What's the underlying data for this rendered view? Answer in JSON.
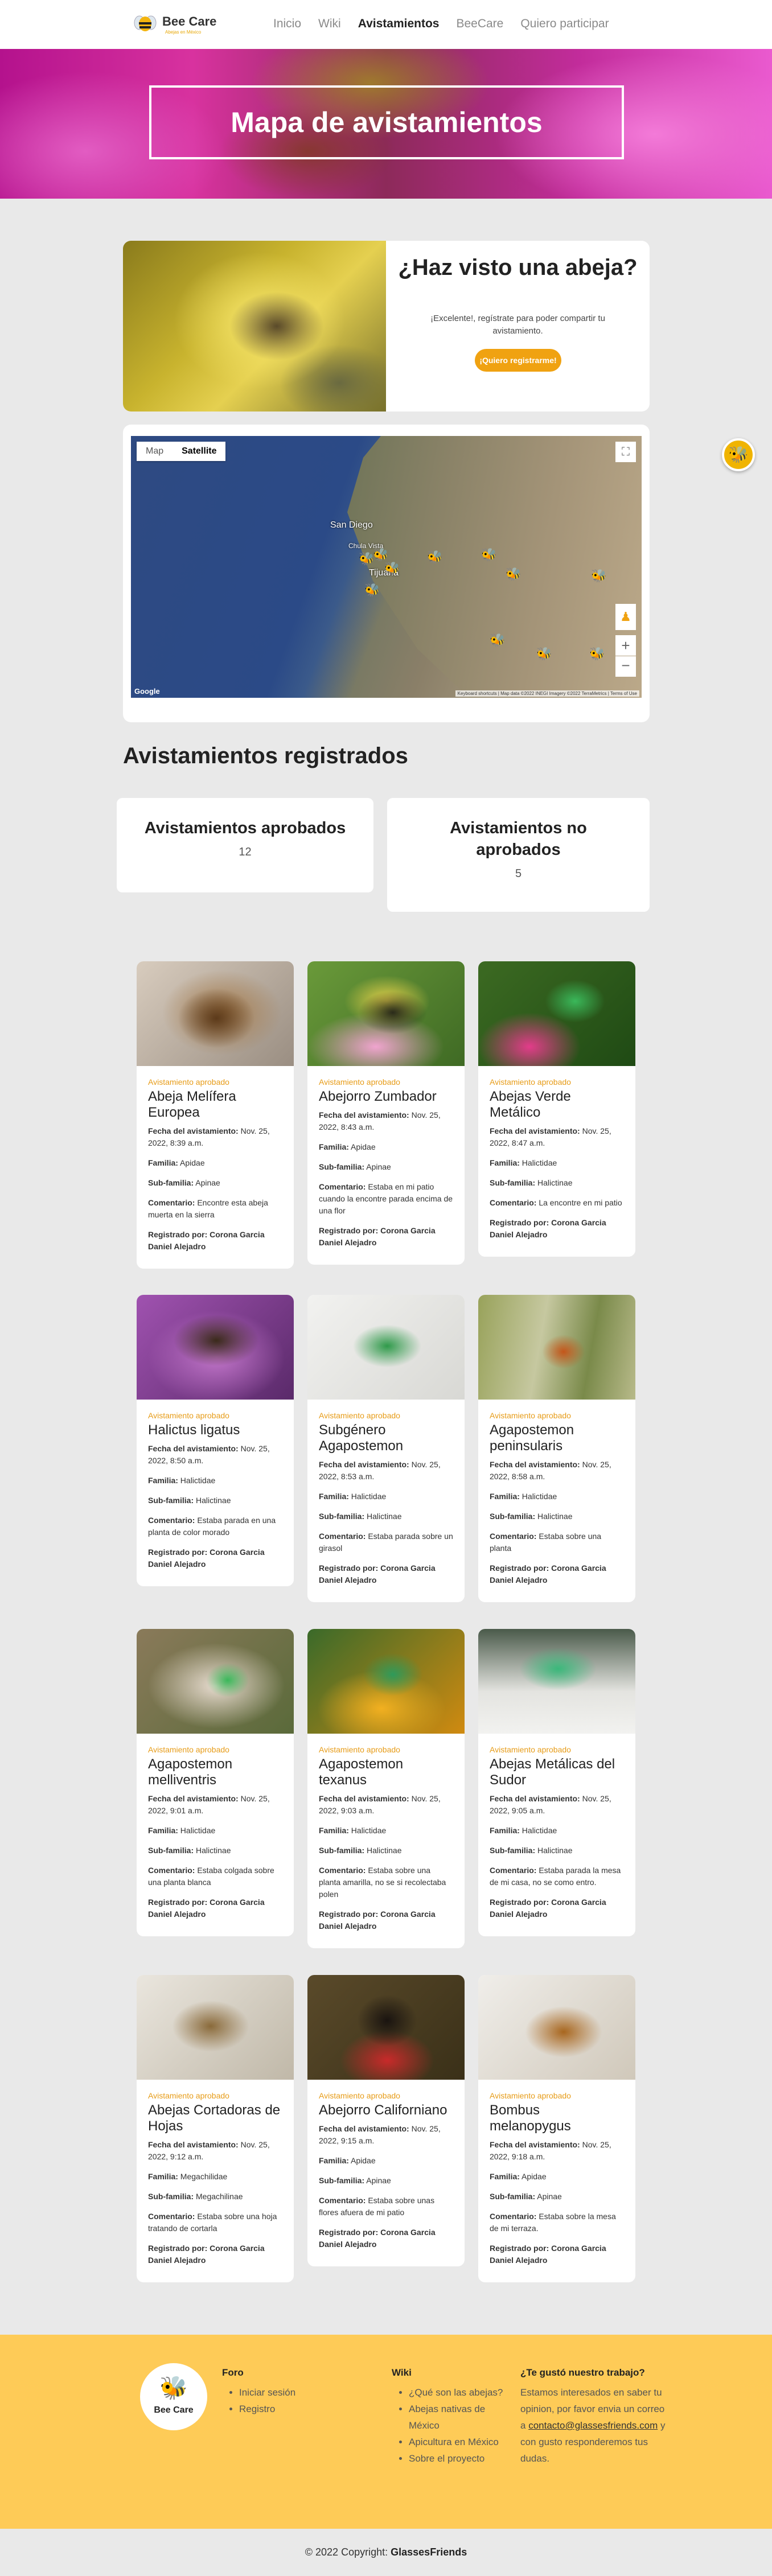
{
  "nav": {
    "brand": "Bee Care",
    "brand_sub": "Abejas en México",
    "links": [
      "Inicio",
      "Wiki",
      "Avistamientos",
      "BeeCare",
      "Quiero participar"
    ],
    "active": "Avistamientos"
  },
  "hero": {
    "title": "Mapa de avistamientos"
  },
  "signup": {
    "title": "¿Haz visto una abeja?",
    "text": "¡Excelente!, regístrate para poder compartir tu avistamiento.",
    "button": "¡Quiero registrarme!"
  },
  "map": {
    "type_map": "Map",
    "type_satellite": "Satellite",
    "label_sd": "San Diego",
    "label_chula": "Chula Vista",
    "label_tijuana": "Tijuana",
    "google": "Google",
    "attribution": "Keyboard shortcuts | Map data ©2022 INEGI Imagery ©2022 TerraMetrics | Terms of Use"
  },
  "registered": {
    "title": "Avistamientos registrados",
    "approved_label": "Avistamientos aprobados",
    "approved_count": "12",
    "not_approved_label": "Avistamientos no aprobados",
    "not_approved_count": "5"
  },
  "labels": {
    "date": "Fecha del avistamiento:",
    "family": "Familia:",
    "subfamily": "Sub-familia:",
    "comment": "Comentario:",
    "registered_by": "Registrado por:"
  },
  "sightings": [
    {
      "status": "Avistamiento aprobado",
      "name": "Abeja Melífera Europea",
      "date": "Nov. 25, 2022, 8:39 a.m.",
      "family": "Apidae",
      "subfamily": "Apinae",
      "comment": "Encontre esta abeja muerta en la sierra",
      "by": "Corona Garcia Daniel Alejadro"
    },
    {
      "status": "Avistamiento aprobado",
      "name": "Abejorro Zumbador",
      "date": "Nov. 25, 2022, 8:43 a.m.",
      "family": "Apidae",
      "subfamily": "Apinae",
      "comment": "Estaba en mi patio cuando la encontre parada encima de una flor",
      "by": "Corona Garcia Daniel Alejadro"
    },
    {
      "status": "Avistamiento aprobado",
      "name": "Abejas Verde Metálico",
      "date": "Nov. 25, 2022, 8:47 a.m.",
      "family": "Halictidae",
      "subfamily": "Halictinae",
      "comment": "La encontre en mi patio",
      "by": "Corona Garcia Daniel Alejadro"
    },
    {
      "status": "Avistamiento aprobado",
      "name": "Halictus ligatus",
      "date": "Nov. 25, 2022, 8:50 a.m.",
      "family": "Halictidae",
      "subfamily": "Halictinae",
      "comment": "Estaba parada en una planta de color morado",
      "by": "Corona Garcia Daniel Alejadro"
    },
    {
      "status": "Avistamiento aprobado",
      "name": "Subgénero Agapostemon",
      "date": "Nov. 25, 2022, 8:53 a.m.",
      "family": "Halictidae",
      "subfamily": "Halictinae",
      "comment": "Estaba parada sobre un girasol",
      "by": "Corona Garcia Daniel Alejadro"
    },
    {
      "status": "Avistamiento aprobado",
      "name": "Agapostemon peninsularis",
      "date": "Nov. 25, 2022, 8:58 a.m.",
      "family": "Halictidae",
      "subfamily": "Halictinae",
      "comment": "Estaba sobre una planta",
      "by": "Corona Garcia Daniel Alejadro"
    },
    {
      "status": "Avistamiento aprobado",
      "name": "Agapostemon melliventris",
      "date": "Nov. 25, 2022, 9:01 a.m.",
      "family": "Halictidae",
      "subfamily": "Halictinae",
      "comment": "Estaba colgada sobre una planta blanca",
      "by": "Corona Garcia Daniel Alejadro"
    },
    {
      "status": "Avistamiento aprobado",
      "name": "Agapostemon texanus",
      "date": "Nov. 25, 2022, 9:03 a.m.",
      "family": "Halictidae",
      "subfamily": "Halictinae",
      "comment": "Estaba sobre una planta amarilla, no se si recolectaba polen",
      "by": "Corona Garcia Daniel Alejadro"
    },
    {
      "status": "Avistamiento aprobado",
      "name": "Abejas Metálicas del Sudor",
      "date": "Nov. 25, 2022, 9:05 a.m.",
      "family": "Halictidae",
      "subfamily": "Halictinae",
      "comment": "Estaba parada la mesa de mi casa, no se como entro.",
      "by": "Corona Garcia Daniel Alejadro"
    },
    {
      "status": "Avistamiento aprobado",
      "name": "Abejas Cortadoras de Hojas",
      "date": "Nov. 25, 2022, 9:12 a.m.",
      "family": "Megachilidae",
      "subfamily": "Megachilinae",
      "comment": "Estaba sobre una hoja tratando de cortarla",
      "by": "Corona Garcia Daniel Alejadro"
    },
    {
      "status": "Avistamiento aprobado",
      "name": "Abejorro Californiano",
      "date": "Nov. 25, 2022, 9:15 a.m.",
      "family": "Apidae",
      "subfamily": "Apinae",
      "comment": "Estaba sobre unas flores afuera de mi patio",
      "by": "Corona Garcia Daniel Alejadro"
    },
    {
      "status": "Avistamiento aprobado",
      "name": "Bombus melanopygus",
      "date": "Nov. 25, 2022, 9:18 a.m.",
      "family": "Apidae",
      "subfamily": "Apinae",
      "comment": "Estaba sobre la mesa de mi terraza.",
      "by": "Corona Garcia Daniel Alejadro"
    }
  ],
  "footer": {
    "logo_text": "Bee Care",
    "foro_title": "Foro",
    "foro_links": [
      "Iniciar sesión",
      "Registro"
    ],
    "wiki_title": "Wiki",
    "wiki_links": [
      "¿Qué son las abejas?",
      "Abejas nativas de México",
      "Apicultura en México",
      "Sobre el proyecto"
    ],
    "contact_title": "¿Te gustó nuestro trabajo?",
    "contact_text_1": "Estamos interesados en saber tu opinion, por favor envia un correo a",
    "contact_email": "contacto@glassesfriends.com",
    "contact_text_2": "y con gusto responderemos tus dudas.",
    "copyright_prefix": "© 2022 Copyright:",
    "copyright_owner": "GlassesFriends"
  },
  "icons": {
    "bee": "bee-icon",
    "marker": "bee-marker-icon"
  },
  "colors": {
    "accent": "#f0a211",
    "footer_bg": "#fecb57",
    "status": "#e79c18"
  }
}
